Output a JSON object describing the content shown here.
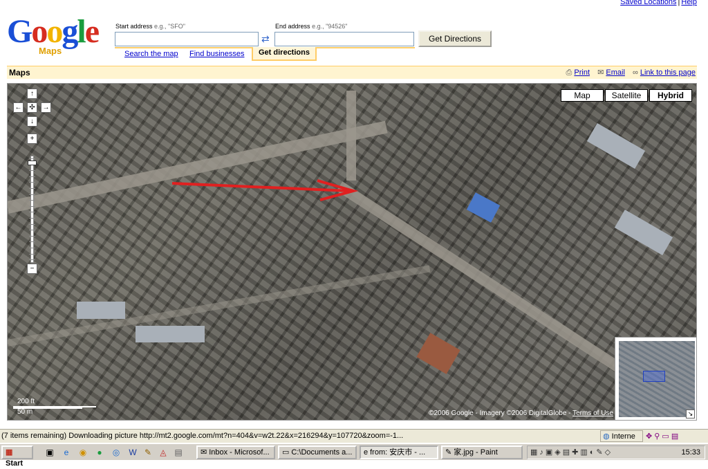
{
  "top_links": {
    "saved_locations": "Saved Locations",
    "sep": "|",
    "help": "Help"
  },
  "logo": {
    "google": "Google",
    "maps": "Maps"
  },
  "start": {
    "label": "Start address",
    "example": "e.g., \"SFO\"",
    "value": ""
  },
  "end": {
    "label": "End address",
    "example": "e.g., \"94526\"",
    "value": ""
  },
  "swap_icon": "⇄",
  "get_directions_button": "Get Directions",
  "tabs": {
    "search": "Search the map",
    "business": "Find businesses",
    "directions": "Get directions"
  },
  "maps_bar": {
    "title": "Maps",
    "print": "Print",
    "email": "Email",
    "link": "Link to this page"
  },
  "map_types": {
    "map": "Map",
    "satellite": "Satellite",
    "hybrid": "Hybrid"
  },
  "pan": {
    "up": "↑",
    "left": "←",
    "center": "✣",
    "right": "→",
    "down": "↓"
  },
  "zoom": {
    "in": "+",
    "out": "−",
    "level_fraction": 0.05
  },
  "scale": {
    "ft": "200 ft",
    "m": "50 m"
  },
  "copyright": {
    "text": "©2006 Google - Imagery ©2006 DigitalGlobe - ",
    "terms": "Terms of Use"
  },
  "overview_toggle": "↘",
  "status_bar": {
    "message": "(7 items remaining) Downloading picture http://mt2.google.com/mt?n=404&v=w2t.22&x=216294&y=107720&zoom=-1...",
    "zone": "Interne"
  },
  "taskbar": {
    "start": "Start",
    "tasks": [
      {
        "label": "Inbox - Microsof..."
      },
      {
        "label": "C:\\Documents a..."
      },
      {
        "label": "from: 安庆市 - ..."
      },
      {
        "label": "家.jpg - Paint"
      }
    ],
    "clock": "15:33"
  },
  "colors": {
    "accent": "#ffcc66",
    "link": "#0000cc",
    "arrow": "#e02020"
  }
}
